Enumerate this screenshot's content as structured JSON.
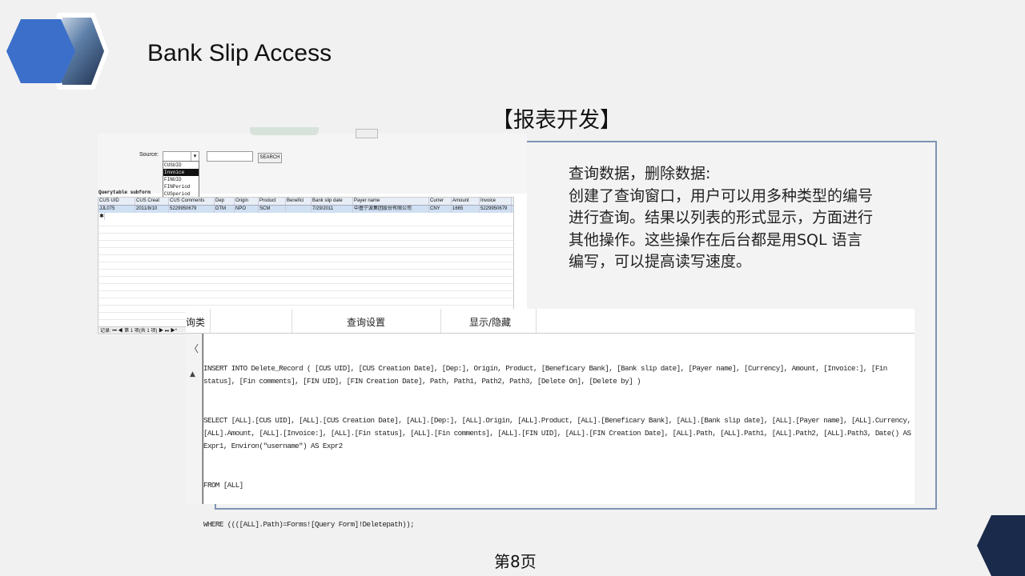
{
  "slide": {
    "title": "Bank Slip Access",
    "section_title": "【报表开发】",
    "description_lines": [
      "查询数据，删除数据:",
      "创建了查询窗口，用户可以用多种类型的编号",
      "进行查询。结果以列表的形式显示，方面进行",
      "其他操作。这些操作在后台都是用SQL 语言",
      "编写，可以提高读写速度。"
    ],
    "page_number": "第8页"
  },
  "access_form": {
    "source_label": "Source:",
    "source_options": [
      "CUSUID",
      "Invoice",
      "FINUID",
      "FINPeriod",
      "CUSperiod"
    ],
    "selected_option": "Invoice",
    "search_button": "SEARCH",
    "subform_label": "Querytable subform",
    "columns": [
      "CUS UID",
      "CUS Creat",
      "CUS Comments",
      "Dep",
      "Origin",
      "Product",
      "Benefici",
      "Bank slip date",
      "Payer name",
      "Currer",
      "Amount",
      "Invoice"
    ],
    "rows": [
      [
        "JJL075",
        "2011/8/10",
        "5229950679",
        "DTM",
        "NPO",
        "SCM",
        "",
        "7/29/2011",
        "中基宁波集团股份有限公司",
        "CNY",
        "1665",
        "5229950679"
      ]
    ],
    "nav_text": "记录: ⏮ ◀ 第 1 项(共 1 项) ▶ ⏭ ▶*"
  },
  "sql_view": {
    "tabs": [
      "询类型",
      "查询设置",
      "显示/隐藏"
    ],
    "lines": [
      "INSERT INTO Delete_Record ( [CUS UID], [CUS Creation Date], [Dep:], Origin, Product, [Beneficary Bank], [Bank slip date], [Payer name], [Currency], Amount, [Invoice:], [Fin status], [Fin comments], [FIN UID], [FIN Creation Date], Path, Path1, Path2, Path3, [Delete On], [Delete by] )",
      "SELECT [ALL].[CUS UID], [ALL].[CUS Creation Date], [ALL].[Dep:], [ALL].Origin, [ALL].Product, [ALL].[Beneficary Bank], [ALL].[Bank slip date], [ALL].[Payer name], [ALL].Currency, [ALL].Amount, [ALL].[Invoice:], [ALL].[Fin status], [ALL].[Fin comments], [ALL].[FIN UID], [ALL].[FIN Creation Date], [ALL].Path, [ALL].Path1, [ALL].Path2, [ALL].Path3, Date() AS Expr1, Environ(\"username\") AS Expr2",
      "FROM [ALL]",
      "WHERE ((([ALL].Path)=Forms![Query Form]!Deletepath));"
    ]
  },
  "colors": {
    "hex_blue": "#3b6fc9",
    "panel_border": "#7f93b3",
    "corner_navy": "#1a2a4a"
  }
}
